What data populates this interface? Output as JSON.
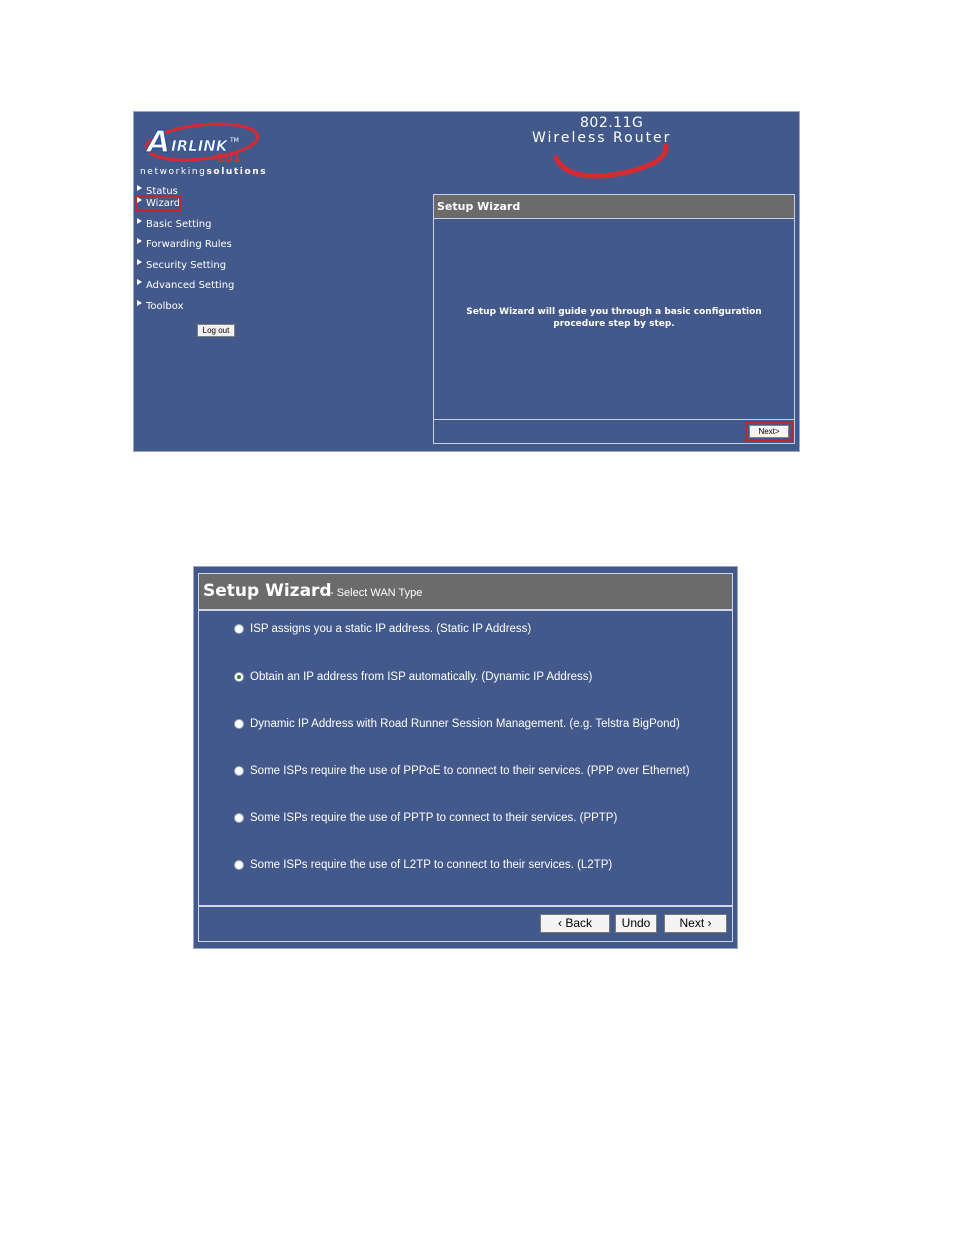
{
  "screen1": {
    "brand": {
      "logo_text": "AIRLINK 101",
      "tagline_prefix": "networking",
      "tagline_suffix": "solutions",
      "product_model": "802.11G",
      "product_name": "Wireless Router"
    },
    "nav": {
      "items": [
        {
          "label": "Status"
        },
        {
          "label": "Wizard"
        },
        {
          "label": "Basic Setting"
        },
        {
          "label": "Forwarding Rules"
        },
        {
          "label": "Security Setting"
        },
        {
          "label": "Advanced Setting"
        },
        {
          "label": "Toolbox"
        }
      ],
      "highlighted": "Wizard",
      "logout_label": "Log out"
    },
    "wizard": {
      "title": "Setup Wizard",
      "description_line1": "Setup Wizard will guide you through a basic configuration",
      "description_line2": "procedure step by step.",
      "next_label": "Next>"
    }
  },
  "screen2": {
    "title": "Setup Wizard",
    "subtitle": "- Select WAN Type",
    "options": [
      {
        "label": "ISP assigns you a static IP address. (Static IP Address)",
        "selected": false
      },
      {
        "label": "Obtain an IP address from ISP automatically. (Dynamic IP Address)",
        "selected": true
      },
      {
        "label": "Dynamic IP Address with Road Runner Session Management. (e.g. Telstra BigPond)",
        "selected": false
      },
      {
        "label": "Some ISPs require the use of PPPoE to connect to their services. (PPP over Ethernet)",
        "selected": false
      },
      {
        "label": "Some ISPs require the use of PPTP to connect to their services. (PPTP)",
        "selected": false
      },
      {
        "label": "Some ISPs require the use of L2TP to connect to their services. (L2TP)",
        "selected": false
      }
    ],
    "buttons": {
      "back": "‹ Back",
      "undo": "Undo",
      "next": "Next ›"
    }
  },
  "colors": {
    "panel_bg": "#43598b",
    "header_bg": "#6b6b6b",
    "highlight_red": "#c0272d",
    "logo_red": "#d62a32",
    "logo_blue": "#1f4fa0"
  }
}
